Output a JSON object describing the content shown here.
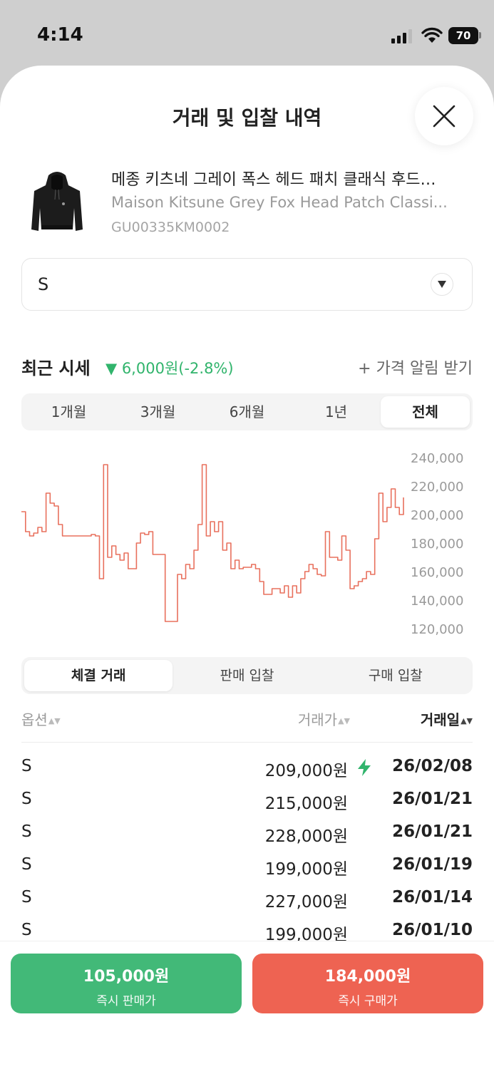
{
  "status_bar": {
    "time": "4:14",
    "battery": "70"
  },
  "sheet": {
    "title": "거래 및 입찰 내역"
  },
  "product": {
    "name_ko": "메종 키츠네 그레이 폭스 헤드 패치 클래식 후드…",
    "name_en": "Maison Kitsune Grey Fox Head Patch Classi...",
    "code": "GU00335KM0002"
  },
  "size_select": {
    "value": "S"
  },
  "recent": {
    "label": "최근 시세",
    "change": "▼ 6,000원(-2.8%)",
    "price_alert": "+ 가격 알림 받기"
  },
  "period_tabs": [
    "1개월",
    "3개월",
    "6개월",
    "1년",
    "전체"
  ],
  "period_selected": "전체",
  "colors": {
    "up": "#ee6352",
    "down": "#42b978",
    "line": "#e8705d"
  },
  "chart_data": {
    "type": "line",
    "yticks": [
      "240,000",
      "220,000",
      "200,000",
      "180,000",
      "160,000",
      "140,000",
      "120,000"
    ],
    "ylim": [
      115000,
      245000
    ],
    "series": [
      {
        "values": [
          202000,
          188000,
          185000,
          187000,
          191000,
          188000,
          215000,
          208000,
          206000,
          193000,
          185000,
          185000,
          185000,
          185000,
          185000,
          185000,
          185000,
          186000,
          185000,
          155000,
          235000,
          170000,
          178000,
          172000,
          168000,
          173000,
          162000,
          162000,
          180000,
          187000,
          186000,
          188000,
          172000,
          172000,
          172000,
          125000,
          125000,
          125000,
          158000,
          155000,
          165000,
          162000,
          175000,
          193000,
          235000,
          185000,
          195000,
          188000,
          195000,
          175000,
          180000,
          162000,
          168000,
          162000,
          163000,
          163000,
          165000,
          162000,
          153000,
          144000,
          144000,
          148000,
          148000,
          145000,
          150000,
          142000,
          150000,
          145000,
          155000,
          160000,
          165000,
          162000,
          158000,
          157000,
          188000,
          170000,
          170000,
          168000,
          185000,
          175000,
          148000,
          150000,
          153000,
          155000,
          160000,
          158000,
          183000,
          215000,
          195000,
          205000,
          218000,
          205000,
          200000,
          212000
        ]
      }
    ]
  },
  "trade_tabs": [
    "체결 거래",
    "판매 입찰",
    "구매 입찰"
  ],
  "trade_selected": "체결 거래",
  "table": {
    "headers": {
      "option": "옵션",
      "price": "거래가",
      "date": "거래일"
    },
    "sort_glyph": "▲▼",
    "rows": [
      {
        "option": "S",
        "price": "209,000원",
        "date": "26/02/08",
        "quick": true
      },
      {
        "option": "S",
        "price": "215,000원",
        "date": "26/01/21",
        "quick": false
      },
      {
        "option": "S",
        "price": "228,000원",
        "date": "26/01/21",
        "quick": false
      },
      {
        "option": "S",
        "price": "199,000원",
        "date": "26/01/19",
        "quick": false
      },
      {
        "option": "S",
        "price": "227,000원",
        "date": "26/01/14",
        "quick": false
      },
      {
        "option": "S",
        "price": "199,000원",
        "date": "26/01/10",
        "quick": false
      }
    ]
  },
  "bottom": {
    "sell_price": "105,000원",
    "sell_label": "즉시 판매가",
    "buy_price": "184,000원",
    "buy_label": "즉시 구매가"
  }
}
